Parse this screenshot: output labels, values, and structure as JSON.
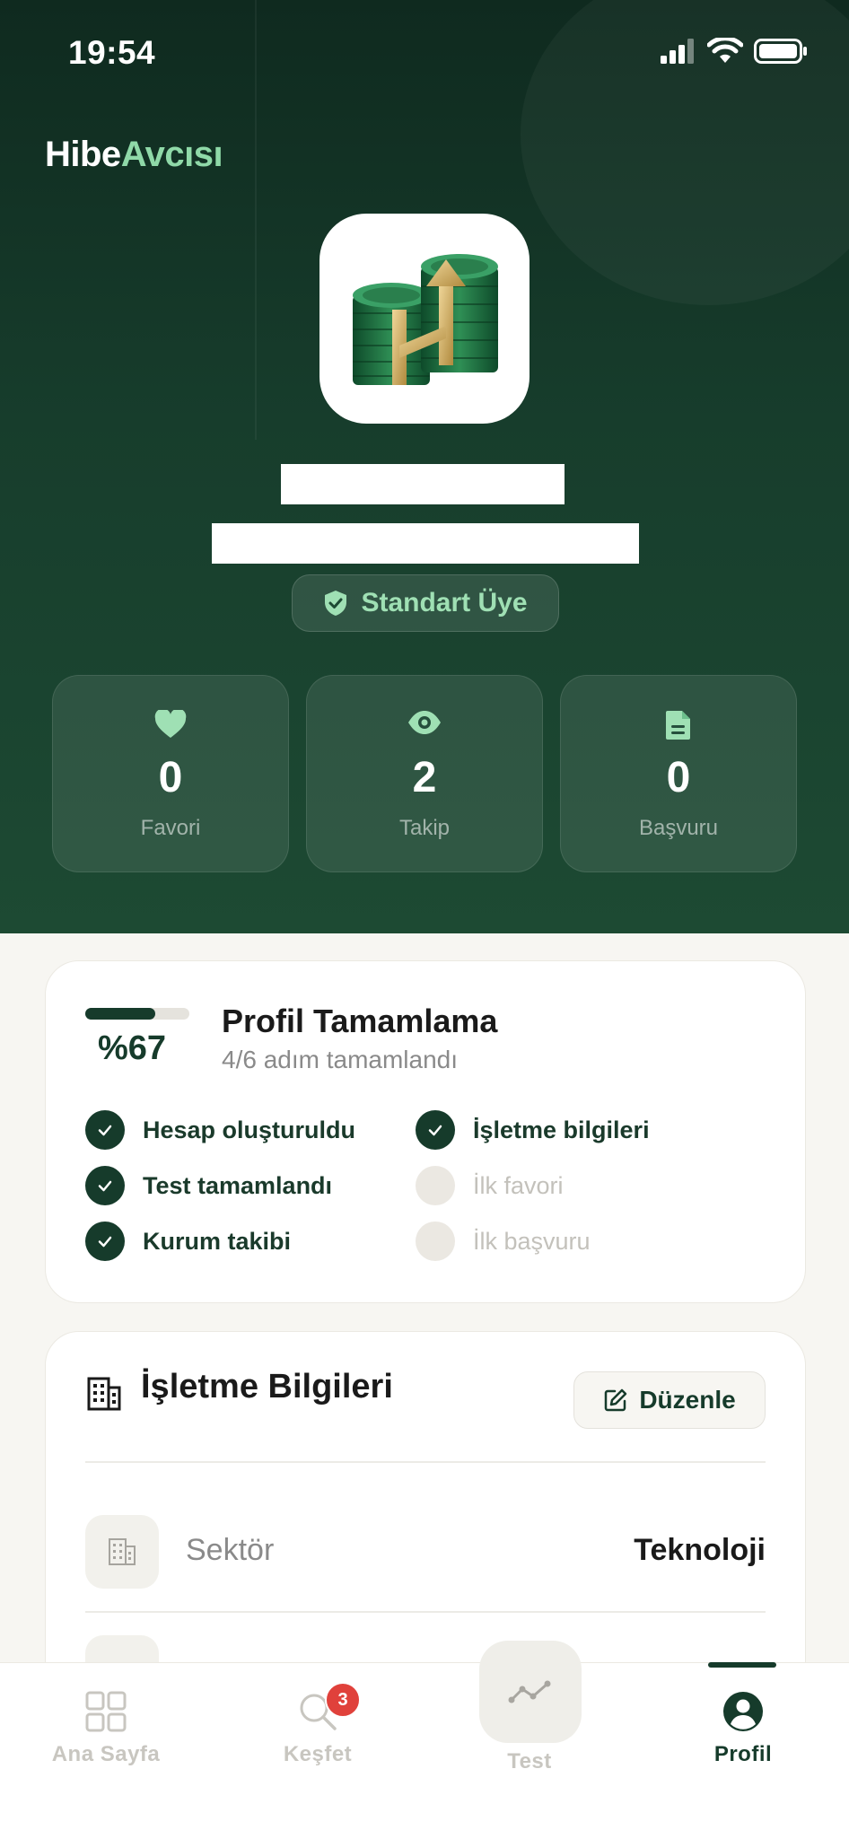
{
  "status_bar": {
    "time": "19:54"
  },
  "brand": {
    "part1": "Hibe",
    "part2": "Avcısı"
  },
  "profile": {
    "membership": "Standart Üye"
  },
  "stats": [
    {
      "icon": "heart-icon",
      "value": "0",
      "label": "Favori"
    },
    {
      "icon": "eye-icon",
      "value": "2",
      "label": "Takip"
    },
    {
      "icon": "document-icon",
      "value": "0",
      "label": "Başvuru"
    }
  ],
  "profile_completion": {
    "percent_text": "%67",
    "percent": 67,
    "title": "Profil Tamamlama",
    "subtitle": "4/6 adım tamamlandı",
    "steps": [
      {
        "label": "Hesap oluşturuldu",
        "done": true
      },
      {
        "label": "İşletme bilgileri",
        "done": true
      },
      {
        "label": "Test tamamlandı",
        "done": true
      },
      {
        "label": "İlk favori",
        "done": false
      },
      {
        "label": "Kurum takibi",
        "done": true
      },
      {
        "label": "İlk başvuru",
        "done": false
      }
    ]
  },
  "business_info": {
    "title": "İşletme Bilgileri",
    "edit_label": "Düzenle",
    "rows": [
      {
        "label": "Sektör",
        "value": "Teknoloji"
      }
    ]
  },
  "tabbar": {
    "tabs": [
      {
        "label": "Ana Sayfa",
        "icon": "grid-icon"
      },
      {
        "label": "Keşfet",
        "icon": "search-icon",
        "badge": "3"
      },
      {
        "label": "Test",
        "icon": "trend-icon"
      },
      {
        "label": "Profil",
        "icon": "user-icon",
        "active": true
      }
    ]
  },
  "colors": {
    "primary": "#163b2b",
    "accent": "#8fd9a8",
    "badge": "#e0413b"
  }
}
